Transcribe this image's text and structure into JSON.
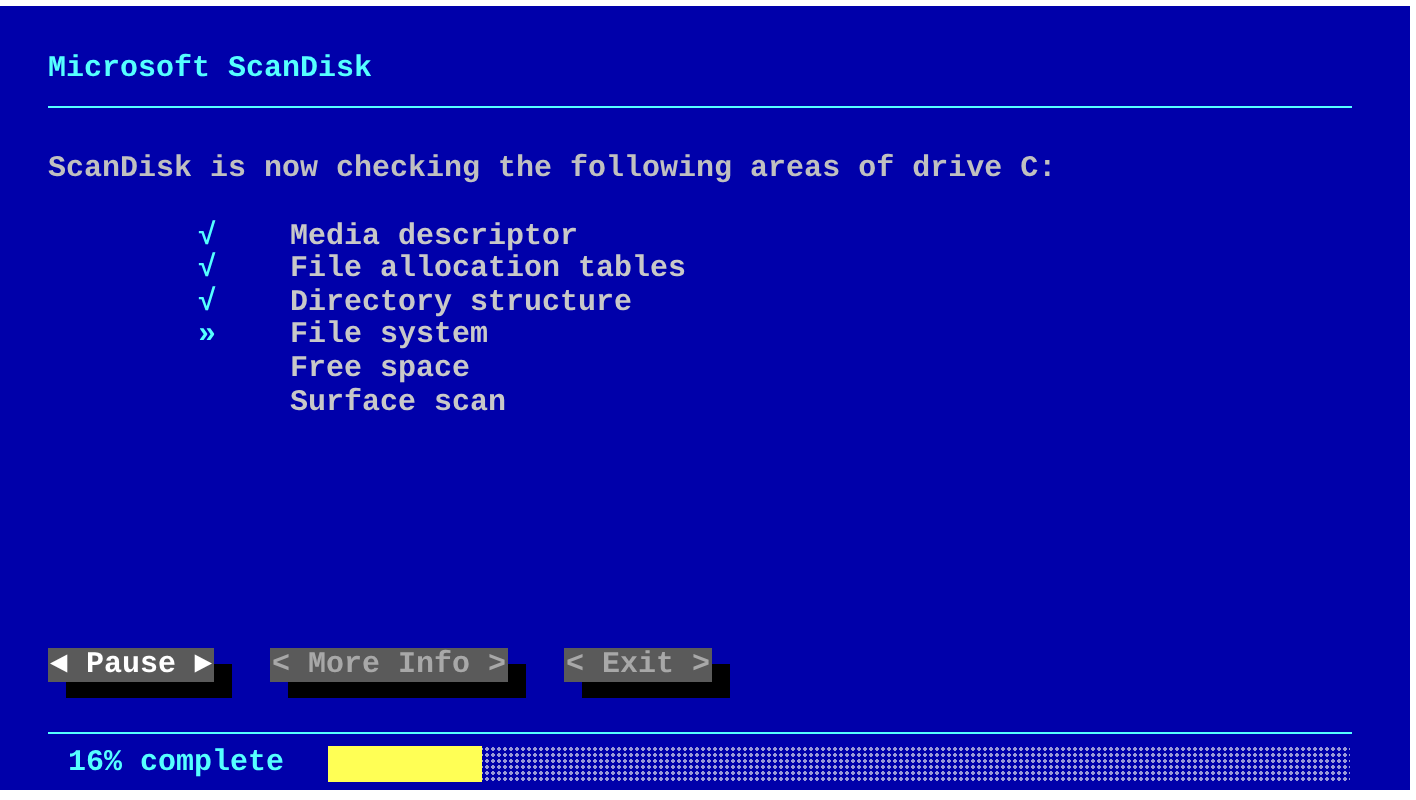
{
  "title": "Microsoft ScanDisk",
  "message": "ScanDisk is now checking the following areas of drive C:",
  "areas": [
    {
      "mark": "√",
      "label": "Media descriptor"
    },
    {
      "mark": "√",
      "label": "File allocation tables"
    },
    {
      "mark": "√",
      "label": "Directory structure"
    },
    {
      "mark": "»",
      "label": "File system"
    },
    {
      "label": "Free space"
    },
    {
      "label": "Surface scan"
    }
  ],
  "buttons": [
    {
      "label": "◄ Pause ►",
      "selected": true
    },
    {
      "label": "< More Info >",
      "selected": false
    },
    {
      "label": "< Exit >",
      "selected": false
    }
  ],
  "progress": {
    "text": "16% complete",
    "level": 0.15
  }
}
